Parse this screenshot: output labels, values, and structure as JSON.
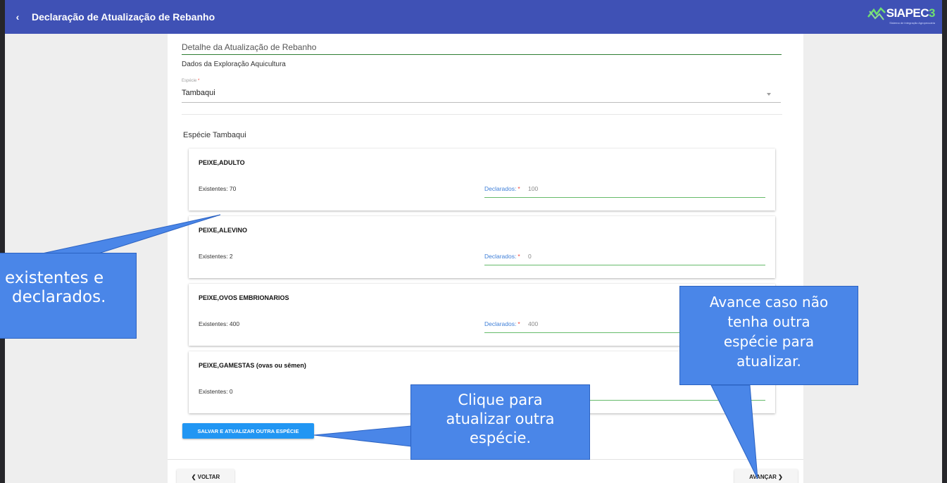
{
  "header": {
    "title": "Declaração de Atualização de Rebanho",
    "back_glyph": "‹",
    "logo_text": "SIAPEC",
    "logo_number": "3",
    "logo_subtitle": "Sistema de Integração Agropecuária"
  },
  "form": {
    "section_title": "Detalhe da Atualização de Rebanho",
    "subsection_title": "Dados da Exploração Aquicultura",
    "species_field": {
      "label": "Espécie",
      "required_mark": "*",
      "value": "Tambaqui"
    },
    "species_heading": "Espécie Tambaqui"
  },
  "cards": [
    {
      "title": "PEIXE,ADULTO",
      "existentes": "Existentes: 70",
      "declarados_label": "Declarados:",
      "required_mark": "*",
      "declarados_value": "100"
    },
    {
      "title": "PEIXE,ALEVINO",
      "existentes": "Existentes: 2",
      "declarados_label": "Declarados:",
      "required_mark": "*",
      "declarados_value": "0"
    },
    {
      "title": "PEIXE,OVOS EMBRIONARIOS",
      "existentes": "Existentes: 400",
      "declarados_label": "Declarados:",
      "required_mark": "*",
      "declarados_value": "400"
    },
    {
      "title": "PEIXE,GAMESTAS (ovas ou sêmen)",
      "existentes": "Existentes: 0",
      "declarados_label": "",
      "required_mark": "",
      "declarados_value": ""
    }
  ],
  "buttons": {
    "save_other": "SALVAR E ATUALIZAR OUTRA ESPÉCIE",
    "back": "❮ VOLTAR",
    "next": "AVANÇAR ❯"
  },
  "callouts": {
    "left": [
      "existentes e",
      "declarados."
    ],
    "middle": [
      "Clique para",
      "atualizar outra",
      "espécie."
    ],
    "right": [
      "Avance caso não",
      "tenha outra",
      "espécie para",
      "atualizar."
    ]
  },
  "colors": {
    "app_bar": "#3f51b5",
    "callout": "#4a86e8",
    "primary_button": "#2196f3",
    "field_underline": "#66bb6a"
  }
}
